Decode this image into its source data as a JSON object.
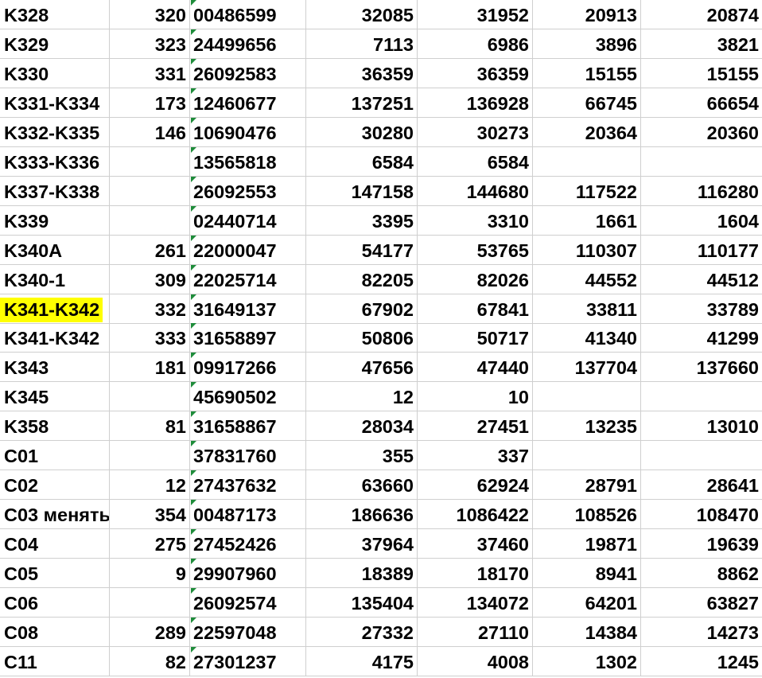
{
  "sheet": {
    "highlight_color": "#ffff00",
    "error_indicator_color": "#1e8c3a",
    "rows": [
      {
        "name": "K328",
        "num": "320",
        "code": "00486599",
        "v1": "32085",
        "v2": "31952",
        "v3": "20913",
        "v4": "20874",
        "highlight": false
      },
      {
        "name": "K329",
        "num": "323",
        "code": "24499656",
        "v1": "7113",
        "v2": "6986",
        "v3": "3896",
        "v4": "3821",
        "highlight": false
      },
      {
        "name": "K330",
        "num": "331",
        "code": "26092583",
        "v1": "36359",
        "v2": "36359",
        "v3": "15155",
        "v4": "15155",
        "highlight": false
      },
      {
        "name": "K331-K334",
        "num": "173",
        "code": "12460677",
        "v1": "137251",
        "v2": "136928",
        "v3": "66745",
        "v4": "66654",
        "highlight": false
      },
      {
        "name": "K332-K335",
        "num": "146",
        "code": "10690476",
        "v1": "30280",
        "v2": "30273",
        "v3": "20364",
        "v4": "20360",
        "highlight": false
      },
      {
        "name": "K333-K336",
        "num": "",
        "code": "13565818",
        "v1": "6584",
        "v2": "6584",
        "v3": "",
        "v4": "",
        "highlight": false
      },
      {
        "name": "K337-K338",
        "num": "",
        "code": "26092553",
        "v1": "147158",
        "v2": "144680",
        "v3": "117522",
        "v4": "116280",
        "highlight": false
      },
      {
        "name": "K339",
        "num": "",
        "code": "02440714",
        "v1": "3395",
        "v2": "3310",
        "v3": "1661",
        "v4": "1604",
        "highlight": false
      },
      {
        "name": "K340A",
        "num": "261",
        "code": "22000047",
        "v1": "54177",
        "v2": "53765",
        "v3": "110307",
        "v4": "110177",
        "highlight": false
      },
      {
        "name": "K340-1",
        "num": "309",
        "code": "22025714",
        "v1": "82205",
        "v2": "82026",
        "v3": "44552",
        "v4": "44512",
        "highlight": false
      },
      {
        "name": "K341-K342",
        "num": "332",
        "code": "31649137",
        "v1": "67902",
        "v2": "67841",
        "v3": "33811",
        "v4": "33789",
        "highlight": true
      },
      {
        "name": "K341-K342",
        "num": "333",
        "code": "31658897",
        "v1": "50806",
        "v2": "50717",
        "v3": "41340",
        "v4": "41299",
        "highlight": false
      },
      {
        "name": "K343",
        "num": "181",
        "code": "09917266",
        "v1": "47656",
        "v2": "47440",
        "v3": "137704",
        "v4": "137660",
        "highlight": false
      },
      {
        "name": "K345",
        "num": "",
        "code": "45690502",
        "v1": "12",
        "v2": "10",
        "v3": "",
        "v4": "",
        "highlight": false
      },
      {
        "name": "K358",
        "num": "81",
        "code": "31658867",
        "v1": "28034",
        "v2": "27451",
        "v3": "13235",
        "v4": "13010",
        "highlight": false
      },
      {
        "name": "C01",
        "num": "",
        "code": "37831760",
        "v1": "355",
        "v2": "337",
        "v3": "",
        "v4": "",
        "highlight": false
      },
      {
        "name": "C02",
        "num": "12",
        "code": "27437632",
        "v1": "63660",
        "v2": "62924",
        "v3": "28791",
        "v4": "28641",
        "highlight": false
      },
      {
        "name": "C03 менять",
        "num": "354",
        "code": "00487173",
        "v1": "186636",
        "v2": "1086422",
        "v3": "108526",
        "v4": "108470",
        "highlight": false
      },
      {
        "name": "C04",
        "num": "275",
        "code": "27452426",
        "v1": "37964",
        "v2": "37460",
        "v3": "19871",
        "v4": "19639",
        "highlight": false
      },
      {
        "name": "C05",
        "num": "9",
        "code": "29907960",
        "v1": "18389",
        "v2": "18170",
        "v3": "8941",
        "v4": "8862",
        "highlight": false
      },
      {
        "name": "C06",
        "num": "",
        "code": "26092574",
        "v1": "135404",
        "v2": "134072",
        "v3": "64201",
        "v4": "63827",
        "highlight": false
      },
      {
        "name": "C08",
        "num": "289",
        "code": "22597048",
        "v1": "27332",
        "v2": "27110",
        "v3": "14384",
        "v4": "14273",
        "highlight": false
      },
      {
        "name": "C11",
        "num": "82",
        "code": "27301237",
        "v1": "4175",
        "v2": "4008",
        "v3": "1302",
        "v4": "1245",
        "highlight": false
      }
    ]
  }
}
